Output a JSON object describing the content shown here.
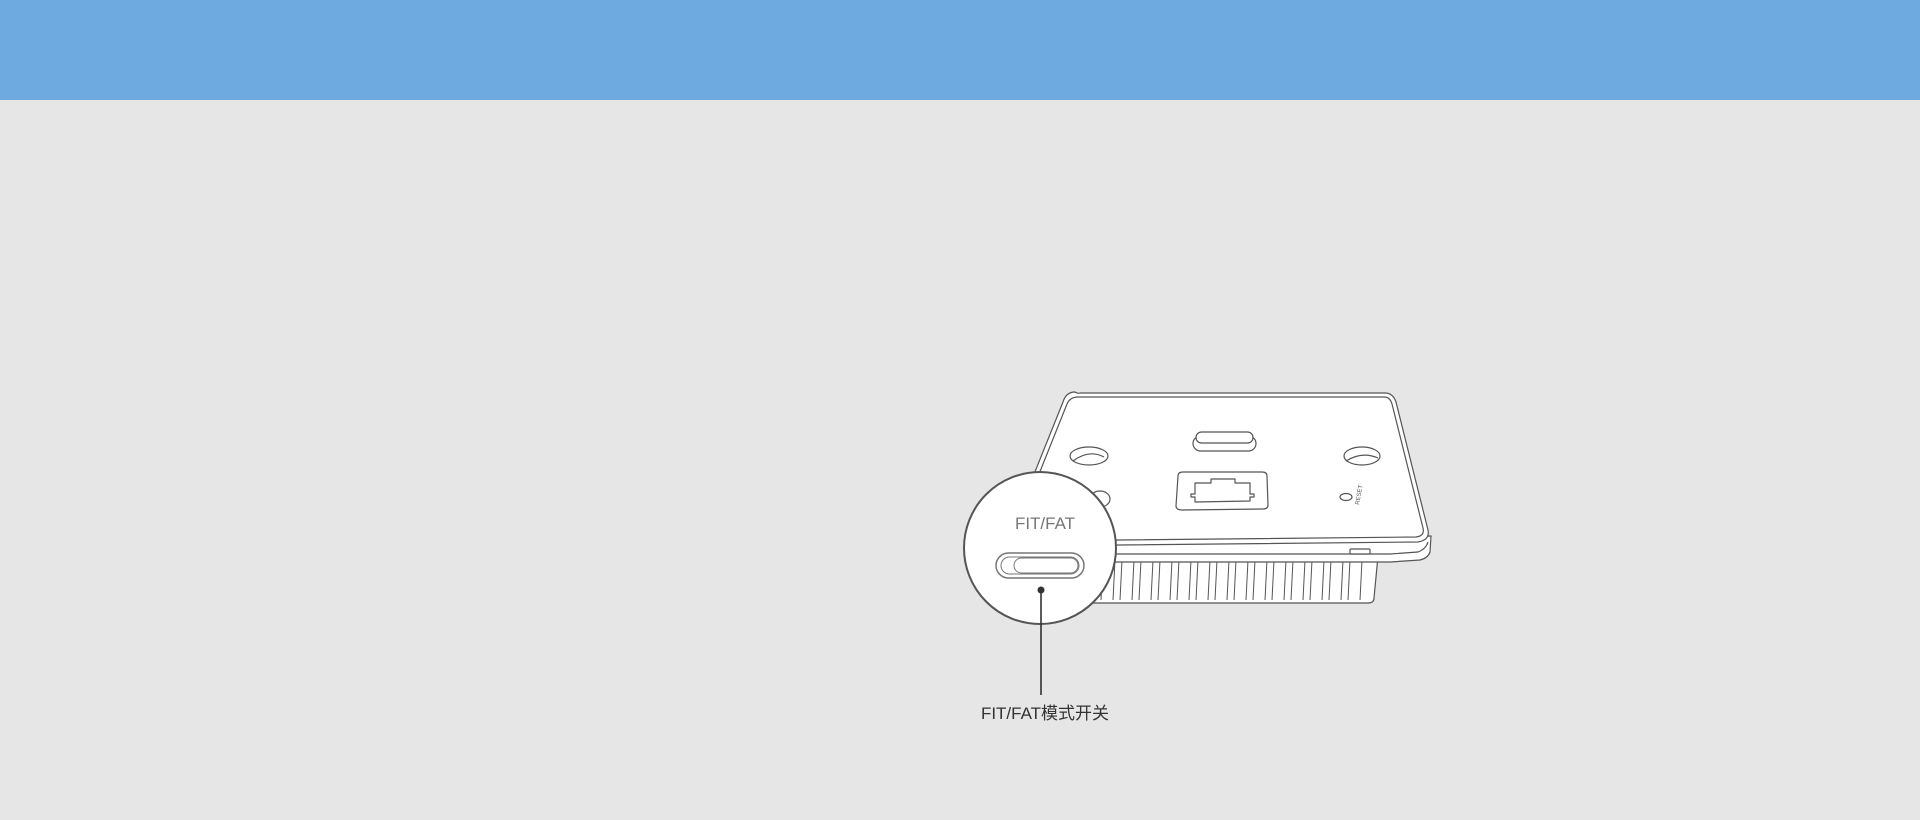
{
  "colors": {
    "banner": "#6eaadf",
    "background": "#e6e6e6",
    "line": "#555555",
    "device_fill": "#ffffff"
  },
  "device": {
    "reset_label": "RESET"
  },
  "zoom_callout": {
    "switch_label": "FIT/FAT"
  },
  "annotation": {
    "label": "FIT/FAT模式开关"
  }
}
